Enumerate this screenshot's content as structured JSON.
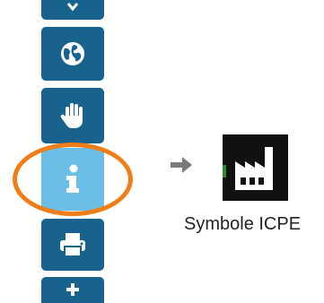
{
  "toolbar": {
    "colors": {
      "button": "#17638d",
      "active_button": "#6bbfe6",
      "icon": "#ffffff"
    },
    "buttons": [
      {
        "name": "top-button-partial",
        "icon": "chevron-down-icon"
      },
      {
        "name": "globe-button",
        "icon": "globe-icon"
      },
      {
        "name": "hand-button",
        "icon": "hand-icon"
      },
      {
        "name": "info-button",
        "icon": "info-icon",
        "active": true
      },
      {
        "name": "print-button",
        "icon": "printer-icon"
      },
      {
        "name": "plus-button",
        "icon": "plus-icon"
      }
    ]
  },
  "highlight": {
    "color": "#f07d16"
  },
  "legend": {
    "arrow_icon": "arrow-right-icon",
    "arrow_color": "#7a7a7a",
    "symbol_icon": "factory-icon",
    "caption": "Symbole ICPE"
  }
}
